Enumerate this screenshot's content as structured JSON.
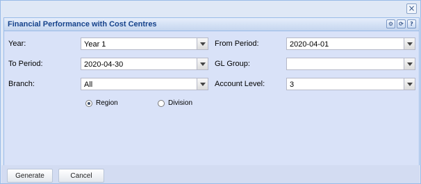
{
  "window": {
    "close_glyph": "×"
  },
  "panel": {
    "title": "Financial Performance with Cost Centres",
    "tools": [
      "gear-icon",
      "refresh-icon",
      "help-icon"
    ],
    "tool_glyphs": {
      "gear": "⚙",
      "refresh": "⟳",
      "help": "?"
    }
  },
  "form": {
    "year": {
      "label": "Year:",
      "value": "Year 1"
    },
    "from_period": {
      "label": "From Period:",
      "value": "2020-04-01"
    },
    "to_period": {
      "label": "To Period:",
      "value": "2020-04-30"
    },
    "gl_group": {
      "label": "GL Group:",
      "value": ""
    },
    "branch": {
      "label": "Branch:",
      "value": "All"
    },
    "account_level": {
      "label": "Account Level:",
      "value": "3"
    },
    "grouping": {
      "options": [
        "Region",
        "Division"
      ],
      "selected": "Region"
    }
  },
  "footer": {
    "generate": "Generate",
    "cancel": "Cancel"
  }
}
